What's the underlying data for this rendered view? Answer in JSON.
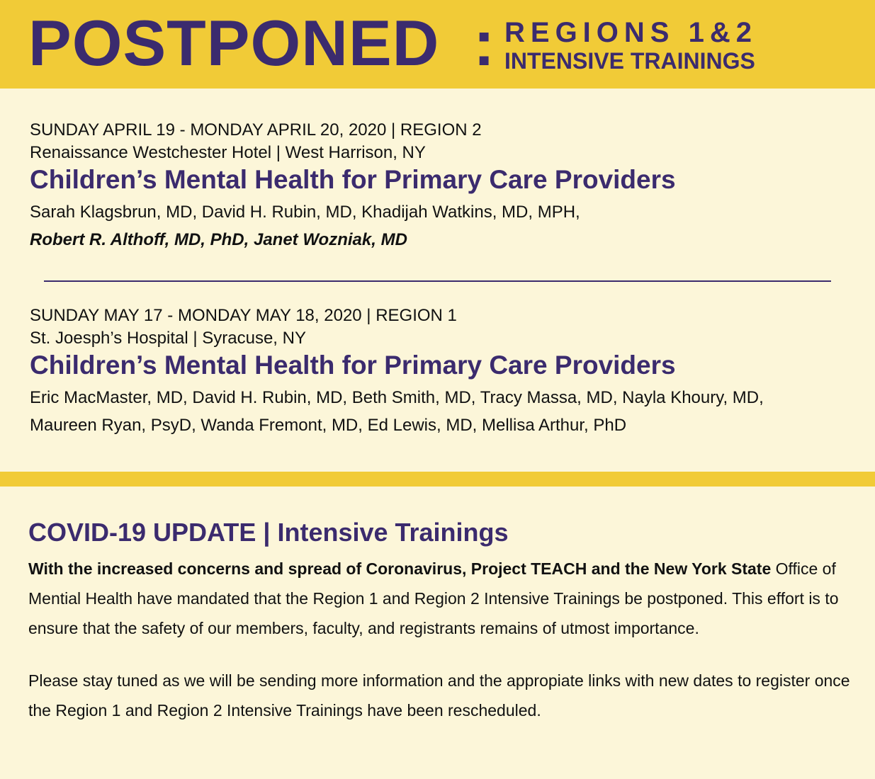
{
  "banner": {
    "main": "POSTPONED",
    "colon": ":",
    "line1": "REGIONS 1&2",
    "line2": "INTENSIVE TRAININGS"
  },
  "events": [
    {
      "date": "SUNDAY APRIL 19 - MONDAY APRIL 20, 2020 | REGION 2",
      "venue": "Renaissance Westchester Hotel | West Harrison, NY",
      "title": "Children’s Mental Health for Primary Care Providers",
      "speakers_line1": "Sarah Klagsbrun, MD, David H. Rubin, MD, Khadijah Watkins, MD, MPH,",
      "speakers_line2": "Robert R. Althoff, MD, PhD, Janet Wozniak, MD"
    },
    {
      "date": "SUNDAY MAY 17 - MONDAY MAY 18, 2020 | REGION 1",
      "venue": "St. Joesph’s Hospital | Syracuse, NY",
      "title": "Children’s Mental Health for Primary Care Providers",
      "speakers_line1": "Eric MacMaster, MD, David H. Rubin, MD, Beth Smith, MD, Tracy Massa, MD, Nayla Khoury, MD,",
      "speakers_line2": "Maureen Ryan, PsyD, Wanda Fremont, MD, Ed Lewis, MD, Mellisa Arthur, PhD"
    }
  ],
  "covid": {
    "title": "COVID-19 UPDATE | Intensive Trainings",
    "paragraph1_lead": "With the increased concerns and spread of Coronavirus, Project TEACH and the New York State",
    "paragraph1_rest": "Office of Mential Health have mandated that the Region 1 and Region 2 Intensive Trainings be postponed.  This effort is to ensure that the safety of our members, faculty, and registrants remains of utmost importance.",
    "paragraph2": "Please stay tuned as we will be sending more information and the appropiate links with new dates to register once the Region 1 and Region 2 Intensive Trainings have been rescheduled."
  },
  "colors": {
    "banner_bg": "#f1cb37",
    "page_bg": "#fcf6d9",
    "accent_purple": "#3b2b6e"
  }
}
